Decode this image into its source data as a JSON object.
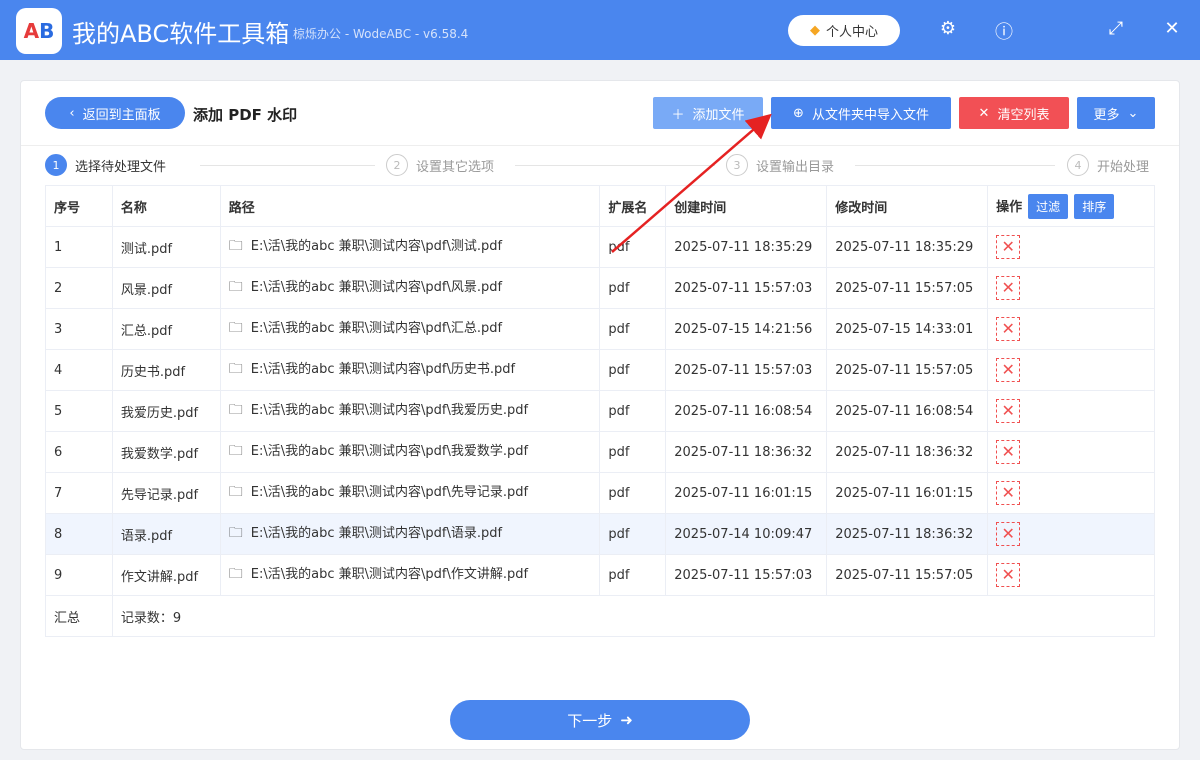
{
  "app": {
    "logo": "AB",
    "title": "我的ABC软件工具箱",
    "subtitle": "椋烁办公 - WodeABC - v6.58.4",
    "user_center": "个人中心"
  },
  "toolbar": {
    "back": "返回到主面板",
    "page_title": "添加 PDF 水印",
    "add_file": "添加文件",
    "import_folder": "从文件夹中导入文件",
    "clear_list": "清空列表",
    "more": "更多"
  },
  "steps": [
    "选择待处理文件",
    "设置其它选项",
    "设置输出目录",
    "开始处理"
  ],
  "table": {
    "headers": [
      "序号",
      "名称",
      "路径",
      "扩展名",
      "创建时间",
      "修改时间",
      "操作"
    ],
    "filter": "过滤",
    "sort": "排序",
    "rows": [
      [
        "1",
        "测试.pdf",
        "E:\\活\\我的abc 兼职\\测试内容\\pdf\\测试.pdf",
        "pdf",
        "2025-07-11 18:35:29",
        "2025-07-11 18:35:29"
      ],
      [
        "2",
        "风景.pdf",
        "E:\\活\\我的abc 兼职\\测试内容\\pdf\\风景.pdf",
        "pdf",
        "2025-07-11 15:57:03",
        "2025-07-11 15:57:05"
      ],
      [
        "3",
        "汇总.pdf",
        "E:\\活\\我的abc 兼职\\测试内容\\pdf\\汇总.pdf",
        "pdf",
        "2025-07-15 14:21:56",
        "2025-07-15 14:33:01"
      ],
      [
        "4",
        "历史书.pdf",
        "E:\\活\\我的abc 兼职\\测试内容\\pdf\\历史书.pdf",
        "pdf",
        "2025-07-11 15:57:03",
        "2025-07-11 15:57:05"
      ],
      [
        "5",
        "我爱历史.pdf",
        "E:\\活\\我的abc 兼职\\测试内容\\pdf\\我爱历史.pdf",
        "pdf",
        "2025-07-11 16:08:54",
        "2025-07-11 16:08:54"
      ],
      [
        "6",
        "我爱数学.pdf",
        "E:\\活\\我的abc 兼职\\测试内容\\pdf\\我爱数学.pdf",
        "pdf",
        "2025-07-11 18:36:32",
        "2025-07-11 18:36:32"
      ],
      [
        "7",
        "先导记录.pdf",
        "E:\\活\\我的abc 兼职\\测试内容\\pdf\\先导记录.pdf",
        "pdf",
        "2025-07-11 16:01:15",
        "2025-07-11 16:01:15"
      ],
      [
        "8",
        "语录.pdf",
        "E:\\活\\我的abc 兼职\\测试内容\\pdf\\语录.pdf",
        "pdf",
        "2025-07-14 10:09:47",
        "2025-07-11 18:36:32"
      ],
      [
        "9",
        "作文讲解.pdf",
        "E:\\活\\我的abc 兼职\\测试内容\\pdf\\作文讲解.pdf",
        "pdf",
        "2025-07-11 15:57:03",
        "2025-07-11 15:57:05"
      ]
    ],
    "summary_label": "汇总",
    "summary_value": "记录数：9"
  },
  "next": "下一步"
}
